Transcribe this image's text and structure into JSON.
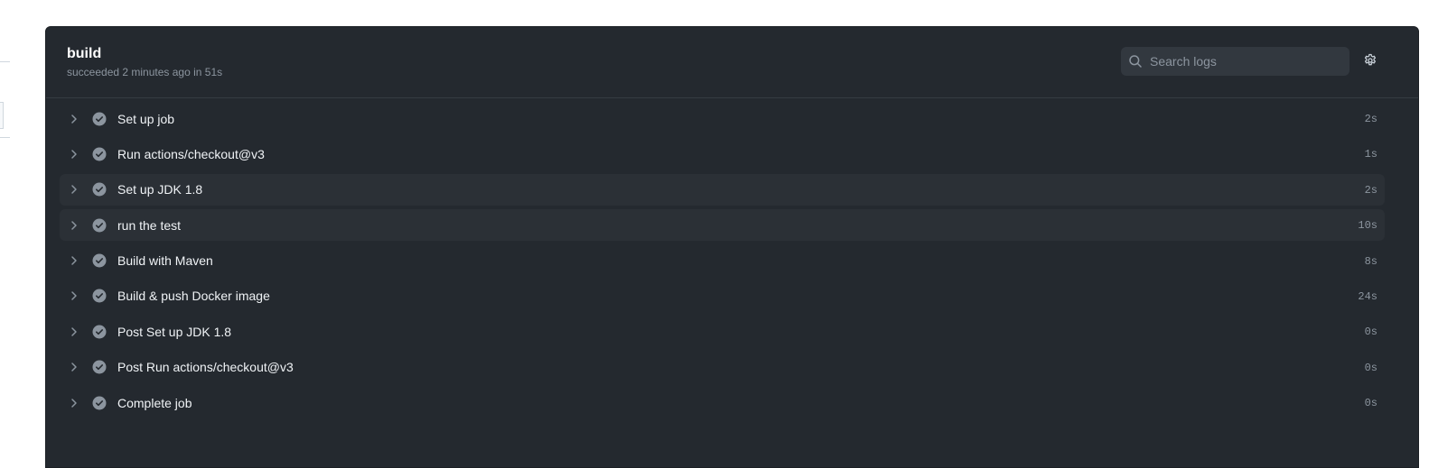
{
  "job": {
    "title": "build",
    "status": "succeeded 2 minutes ago in 51s"
  },
  "search": {
    "placeholder": "Search logs",
    "icon": "search-icon"
  },
  "settings": {
    "icon": "gear-icon"
  },
  "colors": {
    "panel_bg": "#24292f",
    "highlight_row": "#2b3036",
    "text": "#f0f3f6",
    "muted": "#8c959f",
    "check_circle": "#8c959f"
  },
  "steps": [
    {
      "name": "Set up job",
      "duration": "2s",
      "status_icon": "check-circle-icon"
    },
    {
      "name": "Run actions/checkout@v3",
      "duration": "1s",
      "status_icon": "check-circle-icon"
    },
    {
      "name": "Set up JDK 1.8",
      "duration": "2s",
      "status_icon": "check-circle-icon"
    },
    {
      "name": "run the test",
      "duration": "10s",
      "status_icon": "check-circle-icon"
    },
    {
      "name": "Build with Maven",
      "duration": "8s",
      "status_icon": "check-circle-icon"
    },
    {
      "name": "Build & push Docker image",
      "duration": "24s",
      "status_icon": "check-circle-icon"
    },
    {
      "name": "Post Set up JDK 1.8",
      "duration": "0s",
      "status_icon": "check-circle-icon"
    },
    {
      "name": "Post Run actions/checkout@v3",
      "duration": "0s",
      "status_icon": "check-circle-icon"
    },
    {
      "name": "Complete job",
      "duration": "0s",
      "status_icon": "check-circle-icon"
    }
  ]
}
